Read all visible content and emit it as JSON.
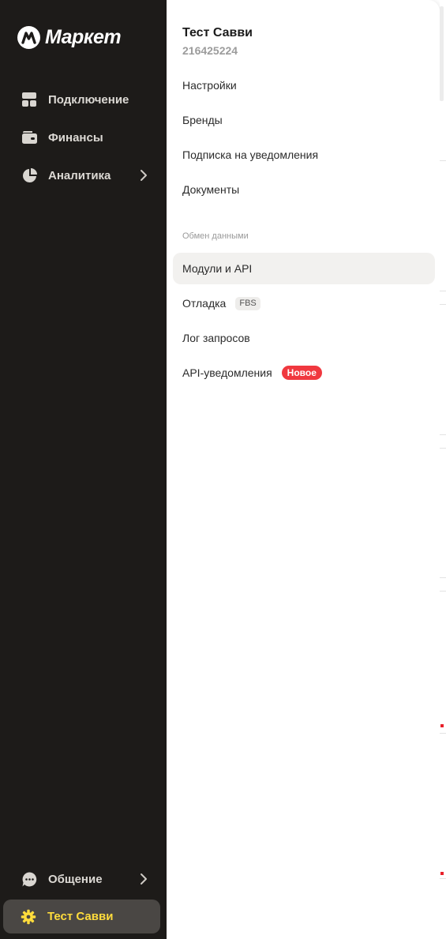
{
  "brand": {
    "logo_text": "Маркет"
  },
  "sidebar": {
    "items": [
      {
        "label": "Подключение",
        "icon": "dashboard-grid-icon"
      },
      {
        "label": "Финансы",
        "icon": "wallet-icon"
      },
      {
        "label": "Аналитика",
        "icon": "pie-chart-icon",
        "has_submenu": true
      }
    ],
    "bottom_items": [
      {
        "label": "Общение",
        "icon": "chat-bubble-icon",
        "has_submenu": true
      },
      {
        "label": "Тест Савви",
        "icon": "gear-icon",
        "active": true
      }
    ],
    "active_color": "#ffdc3c"
  },
  "account_menu": {
    "name": "Тест Савви",
    "id": "216425224",
    "items": [
      {
        "label": "Настройки"
      },
      {
        "label": "Бренды"
      },
      {
        "label": "Подписка на уведомления"
      },
      {
        "label": "Документы"
      }
    ],
    "section_title": "Обмен данными",
    "section_items": [
      {
        "label": "Модули и API",
        "selected": true
      },
      {
        "label": "Отладка",
        "tag": "FBS"
      },
      {
        "label": "Лог запросов"
      },
      {
        "label": "API-уведомления",
        "badge": "Новое"
      }
    ],
    "badge_color": "#f0383f"
  }
}
